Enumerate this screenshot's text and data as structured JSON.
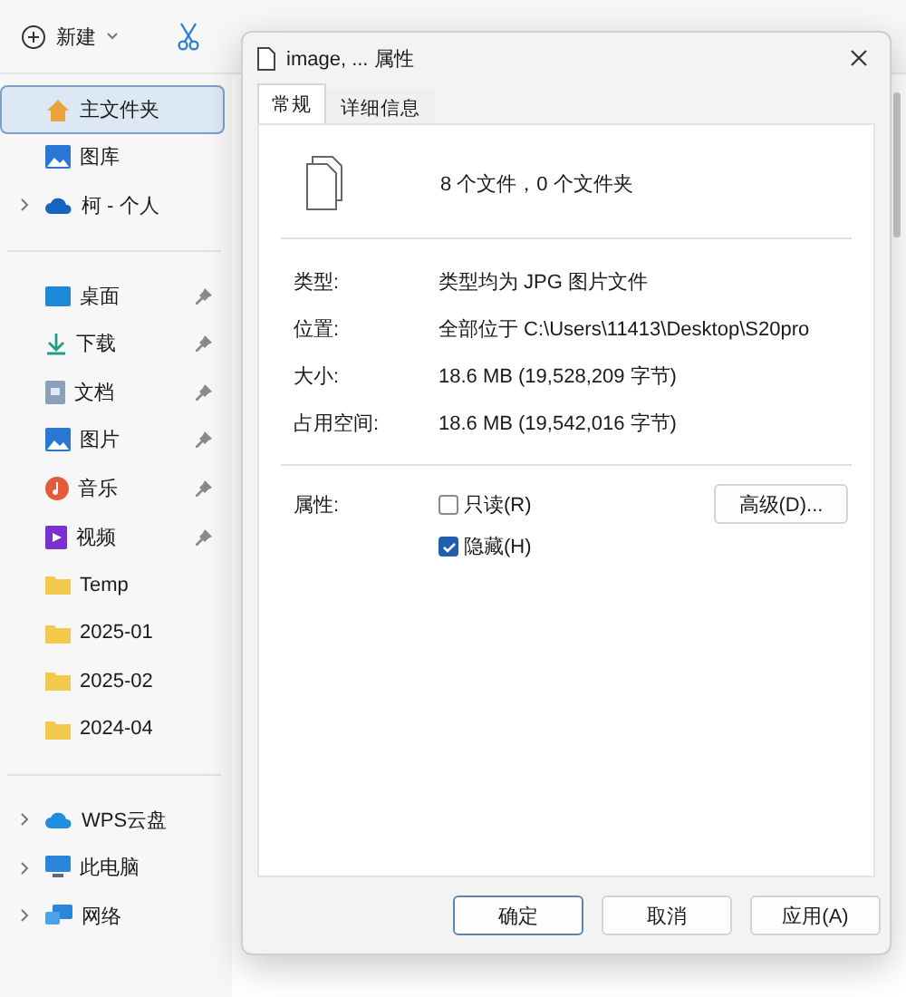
{
  "toolbar": {
    "new_button": "新建"
  },
  "sidebar": {
    "sections": [
      [
        {
          "label": "主文件夹",
          "selected": true,
          "pinned": false,
          "expandable": false
        },
        {
          "label": "图库",
          "selected": false,
          "pinned": false,
          "expandable": false
        },
        {
          "label": "柯 - 个人",
          "selected": false,
          "pinned": false,
          "expandable": true
        }
      ],
      [
        {
          "label": "桌面",
          "selected": false,
          "pinned": true,
          "expandable": false
        },
        {
          "label": "下载",
          "selected": false,
          "pinned": true,
          "expandable": false
        },
        {
          "label": "文档",
          "selected": false,
          "pinned": true,
          "expandable": false
        },
        {
          "label": "图片",
          "selected": false,
          "pinned": true,
          "expandable": false
        },
        {
          "label": "音乐",
          "selected": false,
          "pinned": true,
          "expandable": false
        },
        {
          "label": "视频",
          "selected": false,
          "pinned": true,
          "expandable": false
        },
        {
          "label": "Temp",
          "selected": false,
          "pinned": false,
          "expandable": false
        },
        {
          "label": "2025-01",
          "selected": false,
          "pinned": false,
          "expandable": false
        },
        {
          "label": "2025-02",
          "selected": false,
          "pinned": false,
          "expandable": false
        },
        {
          "label": "2024-04",
          "selected": false,
          "pinned": false,
          "expandable": false
        }
      ],
      [
        {
          "label": "WPS云盘",
          "selected": false,
          "pinned": false,
          "expandable": true
        },
        {
          "label": "此电脑",
          "selected": false,
          "pinned": false,
          "expandable": true
        },
        {
          "label": "网络",
          "selected": false,
          "pinned": false,
          "expandable": true
        }
      ]
    ]
  },
  "dialog": {
    "title": "image, ... 属性",
    "tabs": [
      {
        "label": "常规",
        "selected": true
      },
      {
        "label": "详细信息",
        "selected": false
      }
    ],
    "summary": "8 个文件，0 个文件夹",
    "properties": [
      {
        "label": "类型:",
        "value": "类型均为 JPG 图片文件"
      },
      {
        "label": "位置:",
        "value": "全部位于 C:\\Users\\11413\\Desktop\\S20pro"
      },
      {
        "label": "大小:",
        "value": "18.6 MB (19,528,209 字节)"
      },
      {
        "label": "占用空间:",
        "value": "18.6 MB (19,542,016 字节)"
      }
    ],
    "attributes_label": "属性:",
    "checkboxes": [
      {
        "label": "只读(R)",
        "checked": false
      },
      {
        "label": "隐藏(H)",
        "checked": true
      }
    ],
    "advanced_button": "高级(D)...",
    "buttons": [
      {
        "label": "确定",
        "focused": true
      },
      {
        "label": "取消",
        "focused": false
      },
      {
        "label": "应用(A)",
        "focused": false
      }
    ]
  }
}
